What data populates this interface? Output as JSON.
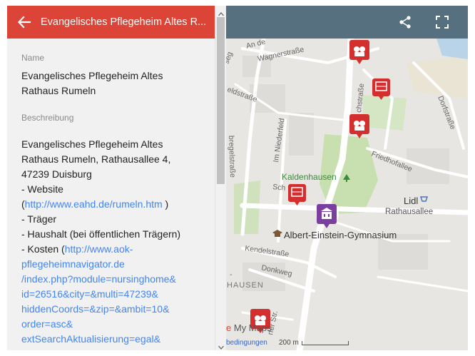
{
  "panel": {
    "title": "Evangelisches Pflegeheim Altes R...",
    "name_label": "Name",
    "name_value": "Evangelisches Pflegeheim Altes Rathaus Rumeln",
    "desc_label": "Beschreibung",
    "desc_lines": {
      "l1": "Evangelisches Pflegeheim Altes Rathaus Rumeln, Rathausallee 4, 47239 Duisburg",
      "website_prefix": "- Website (",
      "website_link": "http://www.eahd.de/rumeln.htm",
      "website_suffix": " )",
      "traeger": "- Träger",
      "haushalt": "- Haushalt (bei öffentlichen Trägern)",
      "kosten_prefix": "- Kosten (",
      "kosten_link_1": "http://www.aok-pflegeheimnavigator.de",
      "kosten_link_2": "/index.php?module=nursinghome&",
      "kosten_link_3": "id=26516&city=&multi=47239&",
      "kosten_link_4": "hiddenCoords=&zip=&ambit=10&",
      "kosten_link_5": "order=asc&",
      "kosten_link_6": "extSearchAktualisierung=egal&"
    }
  },
  "map": {
    "streets": {
      "wagnerstrasse": "Wagnerstraße",
      "an_de": "An de",
      "seg": "seg",
      "eldstrasse": "eldstraße",
      "schstrasse": "chstraße",
      "dorfstrasse": "Dorfstraße",
      "im_niederfeld": "Im Niederfeld",
      "friedhofallee": "Friedhofallee",
      "bregelstrasse": "bregelstraße",
      "sch": "Sch",
      "rathausallee": "Rathausallee",
      "kendelstrasse": "Kendelstraße",
      "donkweg": "Donkweg",
      "rfer_str": "rfer Str.",
      "hausen": "HAUSEN",
      "dash": "-"
    },
    "places": {
      "kaldenhausen": "Kaldenhausen",
      "lidl": "Lidl",
      "gymnasium": "Albert-Einstein-Gymnasium"
    },
    "branding": {
      "my_maps_prefix": "e",
      "my_maps": "My Maps",
      "terms": "bedingungen",
      "scale": "200 m"
    }
  },
  "colors": {
    "header_red": "#db4437",
    "topbar_slate": "#56707f",
    "marker_red": "#d32f2f",
    "marker_purple": "#7b3fa0",
    "link_blue": "#4285f4"
  },
  "icons": {
    "back": "arrow-left-icon",
    "share": "share-icon",
    "fullscreen": "fullscreen-icon",
    "marker": "map-marker-icon"
  }
}
